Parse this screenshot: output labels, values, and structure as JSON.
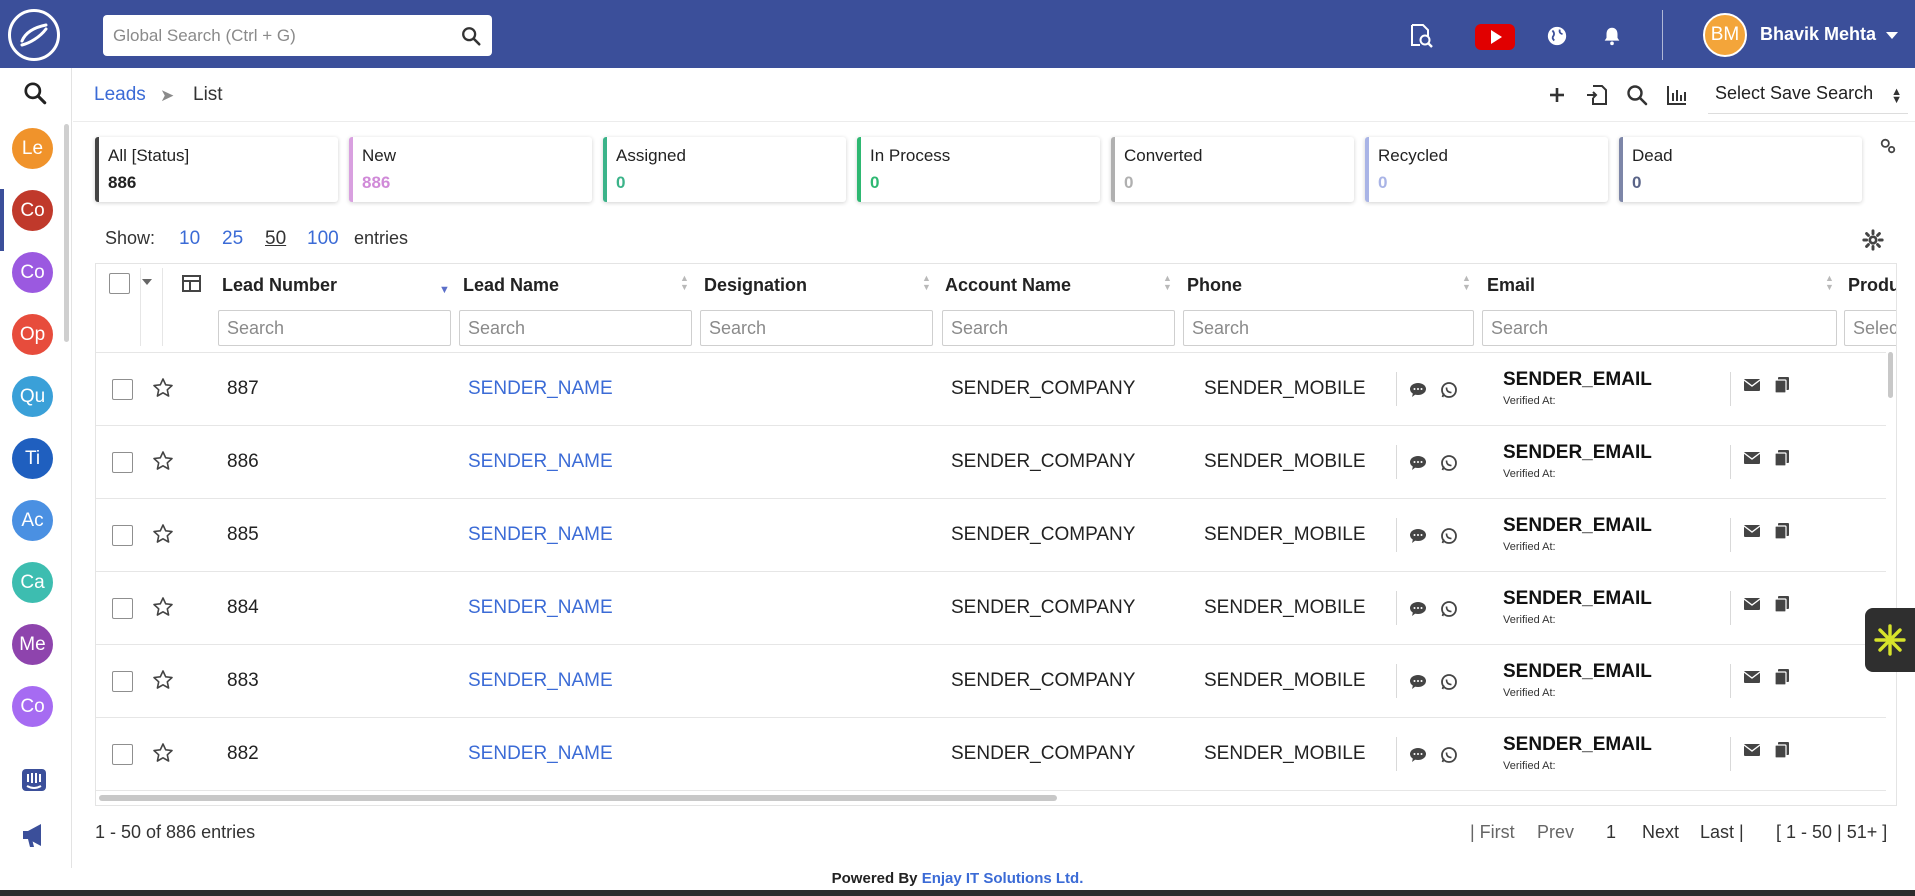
{
  "topbar": {
    "search_placeholder": "Global Search (Ctrl + G)",
    "icons": [
      "search-icon",
      "doc-search-icon",
      "youtube-icon",
      "globe-icon",
      "bell-icon"
    ],
    "user": {
      "initials": "BM",
      "name": "Bhavik Mehta"
    },
    "colors": {
      "bar": "#3b4f9a",
      "avatar": "#f3a53a",
      "youtube": "#e10000"
    }
  },
  "rail": {
    "modules": [
      {
        "initials": "Le",
        "color": "#f0932b"
      },
      {
        "initials": "Co",
        "color": "#c0392b"
      },
      {
        "initials": "Co",
        "color": "#9b59e0"
      },
      {
        "initials": "Op",
        "color": "#e74c3c"
      },
      {
        "initials": "Qu",
        "color": "#3aa0d8"
      },
      {
        "initials": "Ti",
        "color": "#1f5fbf"
      },
      {
        "initials": "Ac",
        "color": "#4a90e2"
      },
      {
        "initials": "Ca",
        "color": "#3dbdb0"
      },
      {
        "initials": "Me",
        "color": "#8e44ad"
      },
      {
        "initials": "Co",
        "color": "#a66bf2"
      }
    ],
    "bottom_icons": [
      "intercom-icon",
      "megaphone-icon"
    ]
  },
  "breadcrumb": {
    "module": "Leads",
    "separator": "➤",
    "page": "List"
  },
  "toolbar": {
    "saved_search": "Select Save Search"
  },
  "status_cards": [
    {
      "label": "All [Status]",
      "count": "886",
      "border": "#444444",
      "count_color": "#222222"
    },
    {
      "label": "New",
      "count": "886",
      "border": "#d9a0e0",
      "count_color": "#d08ad8"
    },
    {
      "label": "Assigned",
      "count": "0",
      "border": "#3bb389",
      "count_color": "#3bb389"
    },
    {
      "label": "In Process",
      "count": "0",
      "border": "#2eb872",
      "count_color": "#2eb872"
    },
    {
      "label": "Converted",
      "count": "0",
      "border": "#b0b0b0",
      "count_color": "#b0b0b0"
    },
    {
      "label": "Recycled",
      "count": "0",
      "border": "#a9b4e6",
      "count_color": "#a9b4e6"
    },
    {
      "label": "Dead",
      "count": "0",
      "border": "#7d86a8",
      "count_color": "#5a6488"
    }
  ],
  "entries": {
    "show_label": "Show:",
    "options": [
      "10",
      "25",
      "50",
      "100"
    ],
    "suffix": "entries"
  },
  "table": {
    "headers": [
      "Lead Number",
      "Lead Name",
      "Designation",
      "Account Name",
      "Phone",
      "Email",
      "Produ"
    ],
    "search_placeholder": "Search",
    "select_placeholder": "Select",
    "verified_label": "Verified At:",
    "rows": [
      {
        "number": "887",
        "name": "SENDER_NAME",
        "account": "SENDER_COMPANY",
        "phone": "SENDER_MOBILE",
        "email": "SENDER_EMAIL"
      },
      {
        "number": "886",
        "name": "SENDER_NAME",
        "account": "SENDER_COMPANY",
        "phone": "SENDER_MOBILE",
        "email": "SENDER_EMAIL"
      },
      {
        "number": "885",
        "name": "SENDER_NAME",
        "account": "SENDER_COMPANY",
        "phone": "SENDER_MOBILE",
        "email": "SENDER_EMAIL"
      },
      {
        "number": "884",
        "name": "SENDER_NAME",
        "account": "SENDER_COMPANY",
        "phone": "SENDER_MOBILE",
        "email": "SENDER_EMAIL"
      },
      {
        "number": "883",
        "name": "SENDER_NAME",
        "account": "SENDER_COMPANY",
        "phone": "SENDER_MOBILE",
        "email": "SENDER_EMAIL"
      },
      {
        "number": "882",
        "name": "SENDER_NAME",
        "account": "SENDER_COMPANY",
        "phone": "SENDER_MOBILE",
        "email": "SENDER_EMAIL"
      }
    ]
  },
  "footer": {
    "summary": "1 - 50 of 886 entries",
    "first": "| First",
    "prev": "Prev",
    "current": "1",
    "next": "Next",
    "last": "Last |",
    "range": "[ 1 - 50 | 51+ ]"
  },
  "powered": {
    "prefix": "Powered By",
    "company": "Enjay IT Solutions Ltd."
  }
}
